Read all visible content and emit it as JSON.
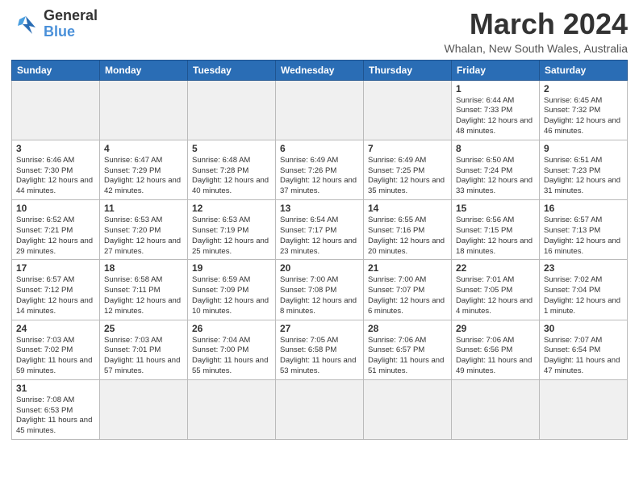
{
  "header": {
    "logo_general": "General",
    "logo_blue": "Blue",
    "month_title": "March 2024",
    "subtitle": "Whalan, New South Wales, Australia"
  },
  "weekdays": [
    "Sunday",
    "Monday",
    "Tuesday",
    "Wednesday",
    "Thursday",
    "Friday",
    "Saturday"
  ],
  "weeks": [
    [
      {
        "day": "",
        "info": "",
        "empty": true
      },
      {
        "day": "",
        "info": "",
        "empty": true
      },
      {
        "day": "",
        "info": "",
        "empty": true
      },
      {
        "day": "",
        "info": "",
        "empty": true
      },
      {
        "day": "",
        "info": "",
        "empty": true
      },
      {
        "day": "1",
        "info": "Sunrise: 6:44 AM\nSunset: 7:33 PM\nDaylight: 12 hours and 48 minutes."
      },
      {
        "day": "2",
        "info": "Sunrise: 6:45 AM\nSunset: 7:32 PM\nDaylight: 12 hours and 46 minutes."
      }
    ],
    [
      {
        "day": "3",
        "info": "Sunrise: 6:46 AM\nSunset: 7:30 PM\nDaylight: 12 hours and 44 minutes."
      },
      {
        "day": "4",
        "info": "Sunrise: 6:47 AM\nSunset: 7:29 PM\nDaylight: 12 hours and 42 minutes."
      },
      {
        "day": "5",
        "info": "Sunrise: 6:48 AM\nSunset: 7:28 PM\nDaylight: 12 hours and 40 minutes."
      },
      {
        "day": "6",
        "info": "Sunrise: 6:49 AM\nSunset: 7:26 PM\nDaylight: 12 hours and 37 minutes."
      },
      {
        "day": "7",
        "info": "Sunrise: 6:49 AM\nSunset: 7:25 PM\nDaylight: 12 hours and 35 minutes."
      },
      {
        "day": "8",
        "info": "Sunrise: 6:50 AM\nSunset: 7:24 PM\nDaylight: 12 hours and 33 minutes."
      },
      {
        "day": "9",
        "info": "Sunrise: 6:51 AM\nSunset: 7:23 PM\nDaylight: 12 hours and 31 minutes."
      }
    ],
    [
      {
        "day": "10",
        "info": "Sunrise: 6:52 AM\nSunset: 7:21 PM\nDaylight: 12 hours and 29 minutes."
      },
      {
        "day": "11",
        "info": "Sunrise: 6:53 AM\nSunset: 7:20 PM\nDaylight: 12 hours and 27 minutes."
      },
      {
        "day": "12",
        "info": "Sunrise: 6:53 AM\nSunset: 7:19 PM\nDaylight: 12 hours and 25 minutes."
      },
      {
        "day": "13",
        "info": "Sunrise: 6:54 AM\nSunset: 7:17 PM\nDaylight: 12 hours and 23 minutes."
      },
      {
        "day": "14",
        "info": "Sunrise: 6:55 AM\nSunset: 7:16 PM\nDaylight: 12 hours and 20 minutes."
      },
      {
        "day": "15",
        "info": "Sunrise: 6:56 AM\nSunset: 7:15 PM\nDaylight: 12 hours and 18 minutes."
      },
      {
        "day": "16",
        "info": "Sunrise: 6:57 AM\nSunset: 7:13 PM\nDaylight: 12 hours and 16 minutes."
      }
    ],
    [
      {
        "day": "17",
        "info": "Sunrise: 6:57 AM\nSunset: 7:12 PM\nDaylight: 12 hours and 14 minutes."
      },
      {
        "day": "18",
        "info": "Sunrise: 6:58 AM\nSunset: 7:11 PM\nDaylight: 12 hours and 12 minutes."
      },
      {
        "day": "19",
        "info": "Sunrise: 6:59 AM\nSunset: 7:09 PM\nDaylight: 12 hours and 10 minutes."
      },
      {
        "day": "20",
        "info": "Sunrise: 7:00 AM\nSunset: 7:08 PM\nDaylight: 12 hours and 8 minutes."
      },
      {
        "day": "21",
        "info": "Sunrise: 7:00 AM\nSunset: 7:07 PM\nDaylight: 12 hours and 6 minutes."
      },
      {
        "day": "22",
        "info": "Sunrise: 7:01 AM\nSunset: 7:05 PM\nDaylight: 12 hours and 4 minutes."
      },
      {
        "day": "23",
        "info": "Sunrise: 7:02 AM\nSunset: 7:04 PM\nDaylight: 12 hours and 1 minute."
      }
    ],
    [
      {
        "day": "24",
        "info": "Sunrise: 7:03 AM\nSunset: 7:02 PM\nDaylight: 11 hours and 59 minutes."
      },
      {
        "day": "25",
        "info": "Sunrise: 7:03 AM\nSunset: 7:01 PM\nDaylight: 11 hours and 57 minutes."
      },
      {
        "day": "26",
        "info": "Sunrise: 7:04 AM\nSunset: 7:00 PM\nDaylight: 11 hours and 55 minutes."
      },
      {
        "day": "27",
        "info": "Sunrise: 7:05 AM\nSunset: 6:58 PM\nDaylight: 11 hours and 53 minutes."
      },
      {
        "day": "28",
        "info": "Sunrise: 7:06 AM\nSunset: 6:57 PM\nDaylight: 11 hours and 51 minutes."
      },
      {
        "day": "29",
        "info": "Sunrise: 7:06 AM\nSunset: 6:56 PM\nDaylight: 11 hours and 49 minutes."
      },
      {
        "day": "30",
        "info": "Sunrise: 7:07 AM\nSunset: 6:54 PM\nDaylight: 11 hours and 47 minutes."
      }
    ],
    [
      {
        "day": "31",
        "info": "Sunrise: 7:08 AM\nSunset: 6:53 PM\nDaylight: 11 hours and 45 minutes."
      },
      {
        "day": "",
        "info": "",
        "empty": true
      },
      {
        "day": "",
        "info": "",
        "empty": true
      },
      {
        "day": "",
        "info": "",
        "empty": true
      },
      {
        "day": "",
        "info": "",
        "empty": true
      },
      {
        "day": "",
        "info": "",
        "empty": true
      },
      {
        "day": "",
        "info": "",
        "empty": true
      }
    ]
  ]
}
